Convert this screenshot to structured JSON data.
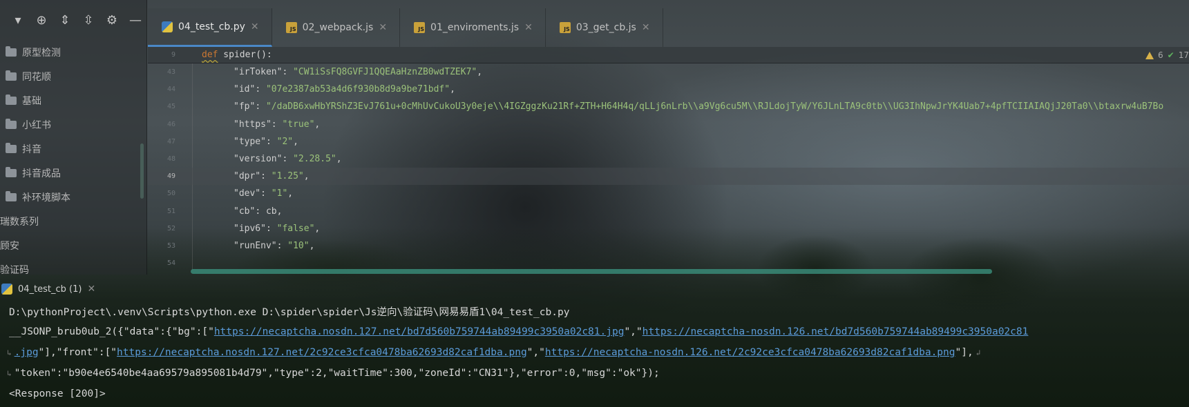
{
  "sidebar": {
    "toolbar_icons": [
      "chevron-down-icon",
      "locate-icon",
      "expand-all-icon",
      "collapse-all-icon",
      "gear-icon",
      "minimize-icon"
    ],
    "items": [
      {
        "label": "原型检测",
        "level": 1
      },
      {
        "label": "同花顺",
        "level": 1
      },
      {
        "label": "基础",
        "level": 1
      },
      {
        "label": "小红书",
        "level": 1
      },
      {
        "label": "抖音",
        "level": 1
      },
      {
        "label": "抖音成品",
        "level": 1
      },
      {
        "label": "补环境脚本",
        "level": 1
      },
      {
        "label": "瑞数系列",
        "level": 0
      },
      {
        "label": "顾安",
        "level": 0
      },
      {
        "label": "验证码",
        "level": 0
      }
    ]
  },
  "tabs": [
    {
      "label": "04_test_cb.py",
      "icon": "python-file-icon",
      "active": true
    },
    {
      "label": "02_webpack.js",
      "icon": "js-file-icon",
      "active": false
    },
    {
      "label": "01_enviroments.js",
      "icon": "js-file-icon",
      "active": false
    },
    {
      "label": "03_get_cb.js",
      "icon": "js-file-icon",
      "active": false
    }
  ],
  "editor": {
    "sticky_line_num": "9",
    "sticky_keyword": "def",
    "sticky_rest": " spider():",
    "inspection": {
      "warnings": "6",
      "ok": "17"
    },
    "lines": [
      {
        "num": "43",
        "key": "\"irToken\"",
        "val": "\"CW1iSsFQ8GVFJ1QQEAaHznZB0wdTZEK7\"",
        "tail": ","
      },
      {
        "num": "44",
        "key": "\"id\"",
        "val": "\"07e2387ab53a4d6f930b8d9a9be71bdf\"",
        "tail": ","
      },
      {
        "num": "45",
        "key": "\"fp\"",
        "val": "\"/daDB6xwHbYRShZ3EvJ761u+0cMhUvCukoU3y0eje\\\\4IGZggzKu21Rf+ZTH+H64H4q/qLLj6nLrb\\\\a9Vg6cu5M\\\\RJLdojTyW/Y6JLnLTA9c0tb\\\\UG3IhNpwJrYK4Uab7+4pfTCIIAIAQjJ20Ta0\\\\btaxrw4uB7Bo",
        "tail": ""
      },
      {
        "num": "46",
        "key": "\"https\"",
        "val": "\"true\"",
        "tail": ","
      },
      {
        "num": "47",
        "key": "\"type\"",
        "val": "\"2\"",
        "tail": ","
      },
      {
        "num": "48",
        "key": "\"version\"",
        "val": "\"2.28.5\"",
        "tail": ","
      },
      {
        "num": "49",
        "key": "\"dpr\"",
        "val": "\"1.25\"",
        "tail": ",",
        "current": true
      },
      {
        "num": "50",
        "key": "\"dev\"",
        "val": "\"1\"",
        "tail": ","
      },
      {
        "num": "51",
        "key": "\"cb\"",
        "val": "cb",
        "tail": ","
      },
      {
        "num": "52",
        "key": "\"ipv6\"",
        "val": "\"false\"",
        "tail": ","
      },
      {
        "num": "53",
        "key": "\"runEnv\"",
        "val": "\"10\"",
        "tail": ","
      },
      {
        "num": "54",
        "key": "",
        "val": "",
        "tail": ""
      }
    ]
  },
  "run": {
    "tab_label": "04_test_cb (1)",
    "console": {
      "cmd": "D:\\pythonProject\\.venv\\Scripts\\python.exe D:\\spider\\spider\\Js逆向\\验证码\\网易易盾1\\04_test_cb.py",
      "l2_pre": "__JSONP_brub0ub_2({\"data\":{\"bg\":[\"",
      "l2_link1": "https://necaptcha.nosdn.127.net/bd7d560b759744ab89499c3950a02c81.jpg",
      "l2_mid": "\",\"",
      "l2_link2": "https://necaptcha-nosdn.126.net/bd7d560b759744ab89499c3950a02c81",
      "l3_link_cont": ".jpg",
      "l3_mid1": "\"],\"front\":[\"",
      "l3_link3": "https://necaptcha.nosdn.127.net/2c92ce3cfca0478ba62693d82caf1dba.png",
      "l3_mid2": "\",\"",
      "l3_link4": "https://necaptcha-nosdn.126.net/2c92ce3cfca0478ba62693d82caf1dba.png",
      "l3_end": "\"],",
      "l4": "\"token\":\"b90e4e6540be4aa69579a895081b4d79\",\"type\":2,\"waitTime\":300,\"zoneId\":\"CN31\"},\"error\":0,\"msg\":\"ok\"});",
      "l5": "<Response [200]>"
    }
  },
  "colors": {
    "accent": "#4a88c7",
    "string": "#9bc27a",
    "keyword": "#cc7832",
    "link": "#5b9bd9"
  }
}
